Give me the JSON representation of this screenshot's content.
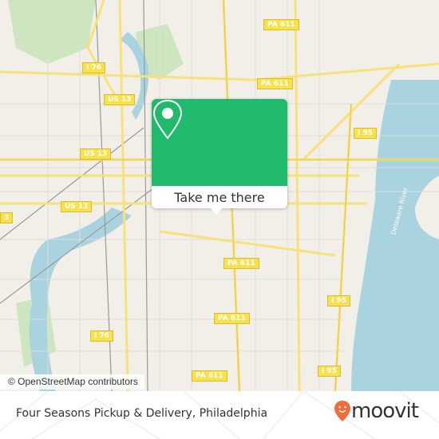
{
  "map": {
    "attribution": "© OpenStreetMap contributors",
    "shields": [
      {
        "label": "PA 611"
      },
      {
        "label": "I 76"
      },
      {
        "label": "PA 611"
      },
      {
        "label": "US 13"
      },
      {
        "label": "US 13"
      },
      {
        "label": "I 95"
      },
      {
        "label": "US 13"
      },
      {
        "label": "PA 611"
      },
      {
        "label": "I 95"
      },
      {
        "label": "PA 611"
      },
      {
        "label": "I 76"
      },
      {
        "label": "I 95"
      },
      {
        "label": "PA 611"
      },
      {
        "label": "3"
      }
    ],
    "river_label": "Delaware River",
    "colors": {
      "land": "#f2efe9",
      "water": "#a9d3de",
      "road": "#f7e27a",
      "accent": "#1fba6b"
    }
  },
  "popup": {
    "button_label": "Take me there",
    "icon": "map-pin-icon"
  },
  "footer": {
    "place_title": "Four Seasons Pickup & Delivery, Philadelphia",
    "brand": "moovit",
    "brand_color": "#f26b3a"
  }
}
